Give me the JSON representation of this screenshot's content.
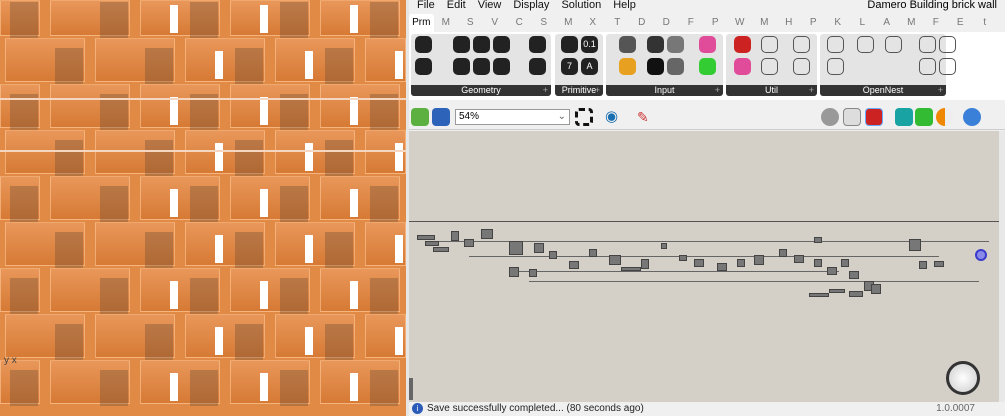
{
  "viewport": {
    "axis_y": "y",
    "axis_x": "x"
  },
  "menu": [
    "File",
    "Edit",
    "View",
    "Display",
    "Solution",
    "Help"
  ],
  "window_title": "Damero Building brick wall",
  "tabs": [
    "Prm",
    "M",
    "S",
    "V",
    "C",
    "S",
    "M",
    "X",
    "T",
    "D",
    "D",
    "F",
    "P",
    "W",
    "M",
    "H",
    "P",
    "K",
    "L",
    "A",
    "M",
    "F",
    "E",
    "t"
  ],
  "groups": [
    {
      "label": "Geometry"
    },
    {
      "label": "Primitive"
    },
    {
      "label": "Input"
    },
    {
      "label": "Util"
    },
    {
      "label": "OpenNest"
    }
  ],
  "primitive_icons": [
    "0.1",
    "7",
    "A"
  ],
  "toolbar": {
    "zoom": "54%"
  },
  "status": {
    "message": "Save successfully completed... (80 seconds ago)",
    "version": "1.0.0007",
    "icon": "info-icon"
  },
  "colors": {
    "canvas": "#d4d0c8",
    "brick": "#e08a45",
    "accent": "#3b3bcc"
  }
}
